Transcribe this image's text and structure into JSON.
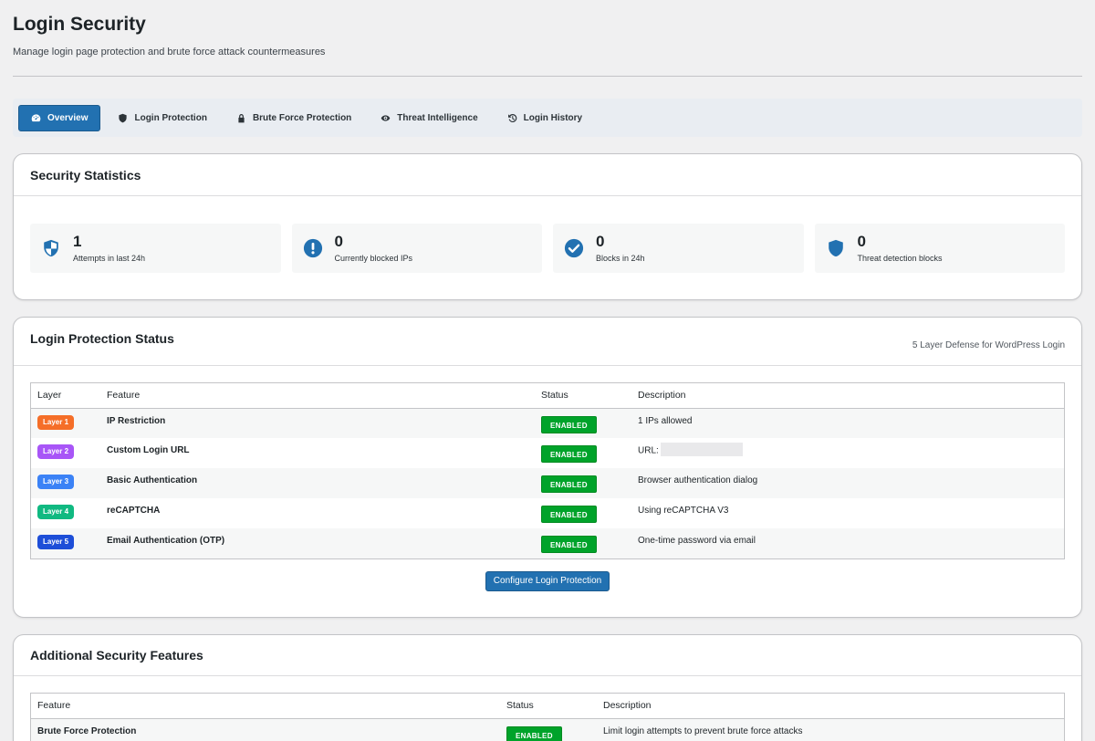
{
  "page": {
    "title": "Login Security",
    "subtitle": "Manage login page protection and brute force attack countermeasures"
  },
  "tabs": [
    {
      "label": "Overview",
      "icon": "dashboard-icon",
      "active": true
    },
    {
      "label": "Login Protection",
      "icon": "shield-icon",
      "active": false
    },
    {
      "label": "Brute Force Protection",
      "icon": "lock-icon",
      "active": false
    },
    {
      "label": "Threat Intelligence",
      "icon": "eye-icon",
      "active": false
    },
    {
      "label": "Login History",
      "icon": "history-icon",
      "active": false
    }
  ],
  "stats": {
    "title": "Security Statistics",
    "items": [
      {
        "value": "1",
        "label": "Attempts in last 24h",
        "icon": "shield-half-icon"
      },
      {
        "value": "0",
        "label": "Currently blocked IPs",
        "icon": "exclamation-circle-icon"
      },
      {
        "value": "0",
        "label": "Blocks in 24h",
        "icon": "check-circle-icon"
      },
      {
        "value": "0",
        "label": "Threat detection blocks",
        "icon": "shield-icon"
      }
    ]
  },
  "protection": {
    "title": "Login Protection Status",
    "meta": "5 Layer Defense for WordPress Login",
    "columns": [
      "Layer",
      "Feature",
      "Status",
      "Description"
    ],
    "rows": [
      {
        "layer": "Layer 1",
        "layer_color": "#f56e28",
        "feature": "IP Restriction",
        "status": "ENABLED",
        "description": "1 IPs allowed"
      },
      {
        "layer": "Layer 2",
        "layer_color": "#a855f7",
        "feature": "Custom Login URL",
        "status": "ENABLED",
        "description": "URL:"
      },
      {
        "layer": "Layer 3",
        "layer_color": "#3b82f6",
        "feature": "Basic Authentication",
        "status": "ENABLED",
        "description": "Browser authentication dialog"
      },
      {
        "layer": "Layer 4",
        "layer_color": "#10b981",
        "feature": "reCAPTCHA",
        "status": "ENABLED",
        "description": "Using reCAPTCHA V3"
      },
      {
        "layer": "Layer 5",
        "layer_color": "#1d4ed8",
        "feature": "Email Authentication (OTP)",
        "status": "ENABLED",
        "description": "One-time password via email"
      }
    ],
    "button_label": "Configure Login Protection"
  },
  "additional": {
    "title": "Additional Security Features",
    "columns": [
      "Feature",
      "Status",
      "Description"
    ],
    "rows": [
      {
        "feature": "Brute Force Protection",
        "status": "ENABLED",
        "description": "Limit login attempts to prevent brute force attacks"
      }
    ]
  },
  "colors": {
    "accent": "#2271b1",
    "enabled": "#00a32a"
  }
}
